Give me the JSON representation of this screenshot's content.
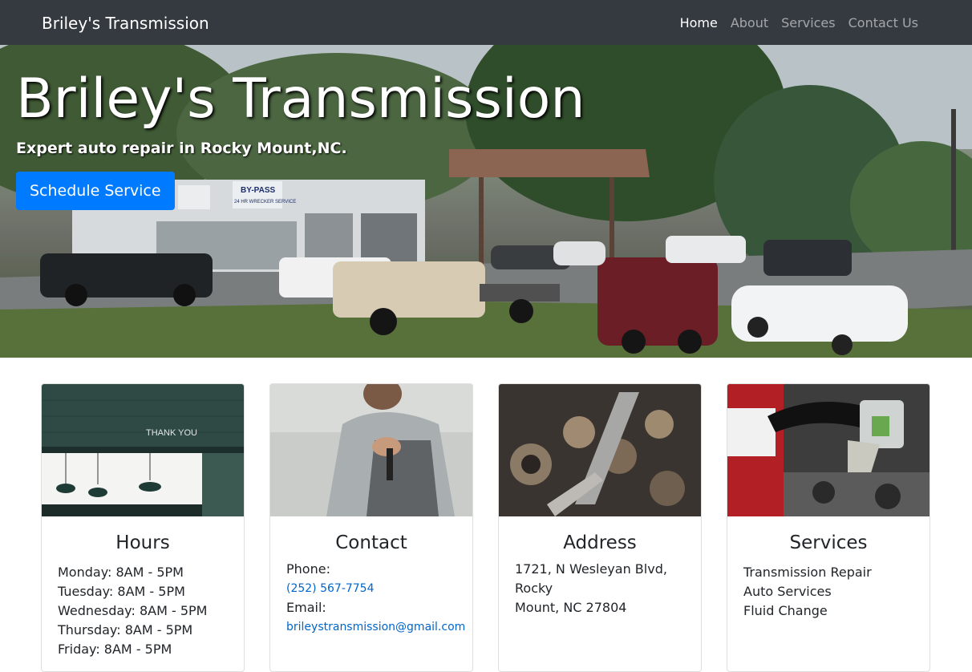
{
  "navbar": {
    "brand": "Briley's Transmission",
    "links": [
      {
        "label": "Home",
        "active": true
      },
      {
        "label": "About",
        "active": false
      },
      {
        "label": "Services",
        "active": false
      },
      {
        "label": "Contact Us",
        "active": false
      }
    ]
  },
  "hero": {
    "title": "Briley's Transmission",
    "subtitle": "Expert auto repair in Rocky Mount,NC.",
    "cta_label": "Schedule Service",
    "sign_text": "BY-PASS",
    "sign_text2": "24 HR WRECKER SERVICE"
  },
  "cards": {
    "hours": {
      "title": "Hours",
      "image_text": "THANK YOU",
      "lines": [
        "Monday: 8AM - 5PM",
        "Tuesday: 8AM - 5PM",
        "Wednesday: 8AM - 5PM",
        "Thursday: 8AM - 5PM",
        "Friday: 8AM - 5PM"
      ]
    },
    "contact": {
      "title": "Contact",
      "phone_label": "Phone:",
      "phone": "(252) 567-7754",
      "email_label": "Email:",
      "email": "brileystransmission@gmail.com"
    },
    "address": {
      "title": "Address",
      "line1": "1721, N Wesleyan Blvd, Rocky",
      "line2": "Mount, NC 27804"
    },
    "services": {
      "title": "Services",
      "items": [
        "Transmission Repair",
        "Auto Services",
        "Fluid Change"
      ]
    }
  },
  "colors": {
    "navbar_bg": "#343a40",
    "primary": "#007bff",
    "link": "#0066cc"
  }
}
